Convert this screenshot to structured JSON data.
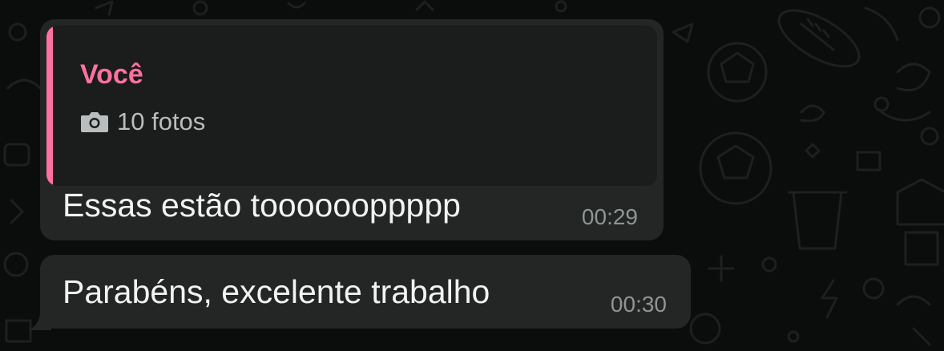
{
  "chat": {
    "quoted": {
      "author": "Você",
      "author_color": "#ff72a0",
      "icon": "camera-icon",
      "media_label": "10 fotos"
    },
    "messages": [
      {
        "text": "Essas estão tooooooppppp",
        "time": "00:29"
      },
      {
        "text": "Parabéns, excelente trabalho",
        "time": "00:30"
      }
    ]
  },
  "colors": {
    "background": "#0b0c0c",
    "bubble": "#232625",
    "quote_background": "#1b1c1c"
  }
}
